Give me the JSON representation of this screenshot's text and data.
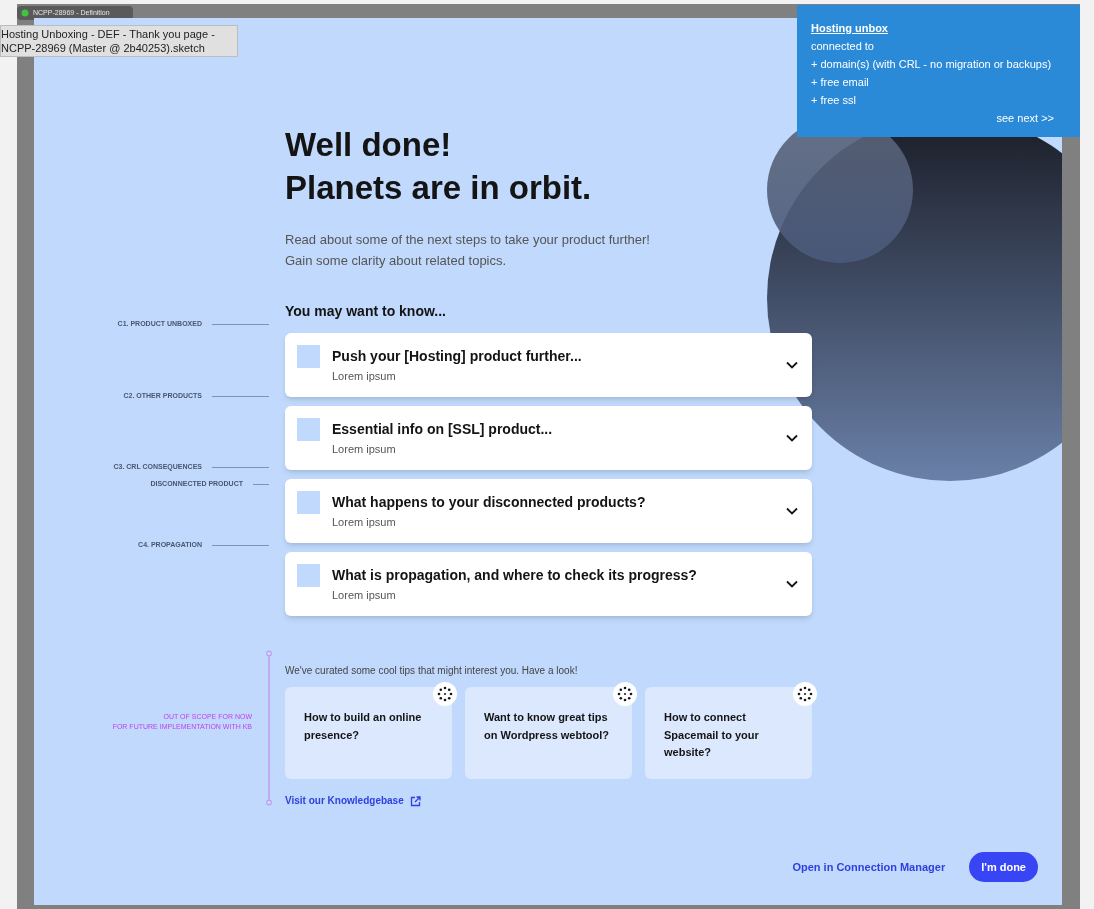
{
  "window": {
    "title": "NCPP-28969 - Definition"
  },
  "tooltip": {
    "lines": [
      "Hosting Unboxing - DEF - Thank you page -",
      "NCPP-28969 (Master @ 2b40253).sketch"
    ]
  },
  "note": {
    "title": "Hosting unbox",
    "lines": [
      "connected to",
      "+ domain(s) (with CRL - no migration or backups)",
      "+ free email",
      "+ free ssl"
    ],
    "link": "see next >>"
  },
  "heading": [
    "Well done!",
    "Planets are in orbit."
  ],
  "intro": [
    "Read about some of the next steps to take your product further!",
    "Gain some clarity about related topics."
  ],
  "section_title": "You may want to know...",
  "accordion": [
    {
      "title": "Push your [Hosting] product further...",
      "subtitle": "Lorem ipsum",
      "expanded": false
    },
    {
      "title": "Essential info on [SSL] product...",
      "subtitle": "Lorem ipsum",
      "expanded": false
    },
    {
      "title": "What happens to your disconnected products?",
      "subtitle": "Lorem ipsum",
      "expanded": false
    },
    {
      "title": "What is propagation, and where to check its progress?",
      "subtitle": "Lorem ipsum",
      "expanded": false
    }
  ],
  "annotations": [
    {
      "label": "C1. PRODUCT UNBOXED",
      "kind": "section"
    },
    {
      "label": "C2. OTHER  PRODUCTS",
      "kind": "section"
    },
    {
      "label": "C3. CRL CONSEQUENCES",
      "kind": "section"
    },
    {
      "label": "DISCONNECTED PRODUCT",
      "kind": "sub"
    },
    {
      "label": "C4. PROPAGATION",
      "kind": "section"
    }
  ],
  "scope_note": [
    "OUT OF SCOPE FOR NOW",
    "FOR FUTURE  IMPLEMENTATION WITH KB"
  ],
  "tips_intro": "We've curated some cool tips that might interest you. Have a look!",
  "tips": [
    {
      "title": "How to build an online presence?"
    },
    {
      "title": "Want to know great tips on Wordpress webtool?"
    },
    {
      "title": "How to connect Spacemail to your website?"
    }
  ],
  "kb_link": "Visit our Knowledgebase",
  "footer": {
    "secondary": "Open in Connection Manager",
    "primary": "I'm done"
  }
}
